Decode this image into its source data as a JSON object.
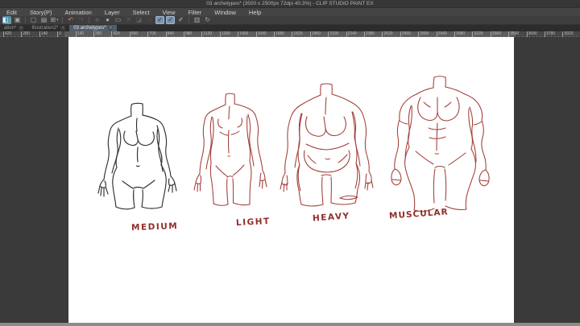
{
  "window": {
    "title": "03 archetypes* (3500 x 2500px 72dpi 40.3%)  - CLIP STUDIO PAINT EX"
  },
  "menu": {
    "items": [
      "Edit",
      "Story(P)",
      "Animation",
      "Layer",
      "Select",
      "View",
      "Filter",
      "Window",
      "Help"
    ]
  },
  "toolbar": {
    "buttons": [
      {
        "name": "app-tool-icon",
        "glyph": "◧",
        "style": "colored",
        "caret": true
      },
      {
        "name": "clip-studio-icon",
        "glyph": "▣"
      },
      {
        "sep": true
      },
      {
        "name": "new-file-icon",
        "glyph": "▢"
      },
      {
        "name": "open-file-icon",
        "glyph": "▤"
      },
      {
        "name": "print-icon",
        "glyph": "⊞",
        "caret": true
      },
      {
        "sep": true
      },
      {
        "name": "undo-icon",
        "glyph": "↶",
        "style": "accent"
      },
      {
        "name": "redo-icon",
        "glyph": "↷",
        "style": "dim"
      },
      {
        "sep": true
      },
      {
        "name": "deselect-icon",
        "glyph": "○"
      },
      {
        "name": "fill-icon",
        "glyph": "●"
      },
      {
        "name": "marquee-icon",
        "glyph": "▭"
      },
      {
        "name": "clear-selection-icon",
        "glyph": "✕",
        "style": "dim"
      },
      {
        "name": "scale-rotate-icon",
        "glyph": "◪",
        "style": "dim"
      },
      {
        "name": "frame-icon",
        "glyph": "□",
        "style": "dim"
      },
      {
        "name": "snap-to-ruler-icon",
        "glyph": "✓",
        "style": "active"
      },
      {
        "name": "snap-to-special-ruler-icon",
        "glyph": "✓",
        "style": "active"
      },
      {
        "name": "snap-to-grid-icon",
        "glyph": "✐"
      },
      {
        "sep": true
      },
      {
        "name": "panel-icon",
        "glyph": "▥"
      },
      {
        "name": "reset-display-icon",
        "glyph": "↻"
      }
    ]
  },
  "tabs": [
    {
      "label": "ation*",
      "active": false
    },
    {
      "label": "Illustration2*",
      "active": false
    },
    {
      "label": "03 archetypes*",
      "active": true
    }
  ],
  "ui": {
    "close_glyph": "×"
  },
  "ruler": {
    "unit": "px",
    "step": 140,
    "labels": [
      "420",
      "280",
      "140",
      "0",
      "140",
      "280",
      "420",
      "560",
      "700",
      "840",
      "980",
      "1120",
      "1260",
      "1400",
      "1540",
      "1680",
      "1820",
      "1960",
      "2100",
      "2240",
      "2380",
      "2520",
      "2660",
      "2800",
      "2940",
      "3080",
      "3220",
      "3360",
      "3500",
      "3640",
      "3780",
      "3920"
    ]
  },
  "canvas": {
    "document_size": "3500 x 2500px",
    "zoom": "40.3%",
    "figures": [
      {
        "id": "medium",
        "label": "MEDIUM",
        "ink": "#332f2f"
      },
      {
        "id": "light",
        "label": "LIGHT",
        "ink": "#a23c35"
      },
      {
        "id": "heavy",
        "label": "HEAVY",
        "ink": "#a23c35"
      },
      {
        "id": "muscular",
        "label": "MUSCULAR",
        "ink": "#a23c35"
      }
    ]
  },
  "colors": {
    "titlebar_bg": "#363636",
    "menubar_bg": "#454545",
    "toolbar_bg": "#3e3e3e",
    "tabbar_bg": "#2c2c2c",
    "active_tab_bg": "#535c67",
    "snap_active_bg": "#7b93ad",
    "undo_accent": "#c98a4d",
    "pasteboard": "#3a3a3a",
    "page": "#ffffff",
    "sketch_red": "#a23c35",
    "sketch_black": "#332f2f",
    "label_red": "#8f2e2a"
  }
}
